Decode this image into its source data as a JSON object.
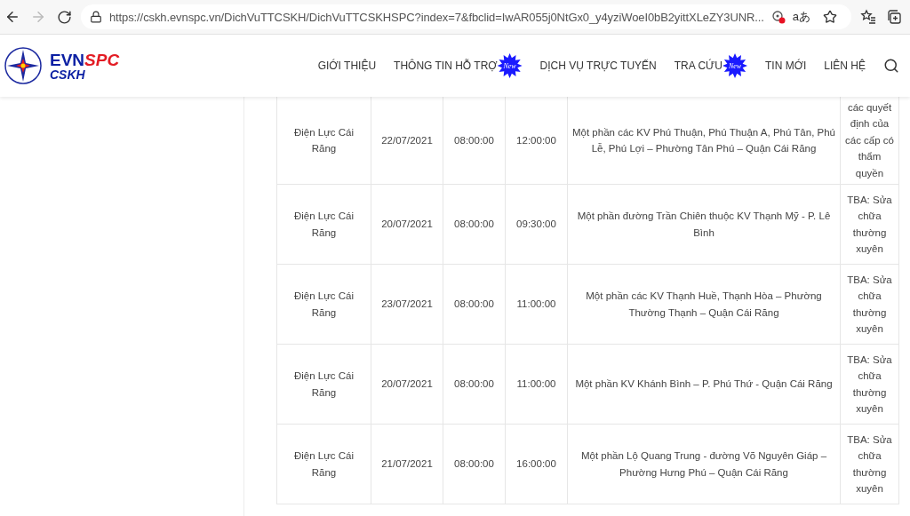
{
  "browser": {
    "url": "https://cskh.evnspc.vn/DichVuTTCSKH/DichVuTTCSKHSPC?index=7&fbclid=IwAR055j0NtGx0_y4yziWoeI0bB2yittXLeZY3UNR...",
    "read_aloud": "aあ",
    "forward_disabled": true
  },
  "logo": {
    "brand_a": "EVN",
    "brand_b": "SPC",
    "subtitle": "CSKH"
  },
  "nav": [
    {
      "label": "GIỚI THIỆU"
    },
    {
      "label": "THÔNG TIN HỖ TRỢ",
      "badge": "New"
    },
    {
      "label": "DỊCH VỤ TRỰC TUYẾN"
    },
    {
      "label": "TRA CỨU",
      "badge": "New"
    },
    {
      "label": "TIN MỚI"
    },
    {
      "label": "LIÊN HỆ"
    }
  ],
  "table": {
    "rows": [
      {
        "cells": [
          "Điện Lực Cái Răng",
          "22/07/2021",
          "08:00:00",
          "12:00:00",
          "Một phần các KV Phú Thuận, Phú Thuận A, Phú Tân, Phú Lễ, Phú Lợi – Phường Tân Phú – Quận Cái Răng",
          "các quyết định của các cấp có thẩm quyền"
        ]
      },
      {
        "cells": [
          "Điện Lực Cái Răng",
          "20/07/2021",
          "08:00:00",
          "09:30:00",
          "Một phần đường Trần Chiên thuộc KV Thạnh Mỹ - P. Lê Bình",
          "TBA: Sửa chữa thường xuyên"
        ]
      },
      {
        "cells": [
          "Điện Lực Cái Răng",
          "23/07/2021",
          "08:00:00",
          "11:00:00",
          "Một phần các KV Thạnh Huề, Thạnh Hòa – Phường Thường Thạnh – Quận Cái Răng",
          "TBA: Sửa chữa thường xuyên"
        ]
      },
      {
        "cells": [
          "Điện Lực Cái Răng",
          "20/07/2021",
          "08:00:00",
          "11:00:00",
          "Một phần KV Khánh Bình – P. Phú Thứ - Quận Cái Răng",
          "TBA: Sửa chữa thường xuyên"
        ]
      },
      {
        "cells": [
          "Điện Lực Cái Răng",
          "21/07/2021",
          "08:00:00",
          "16:00:00",
          "Một phần Lộ Quang Trung - đường Võ Nguyên Giáp – Phường Hưng Phú – Quận Cái Răng",
          "TBA: Sửa chữa thường xuyên"
        ]
      }
    ]
  }
}
